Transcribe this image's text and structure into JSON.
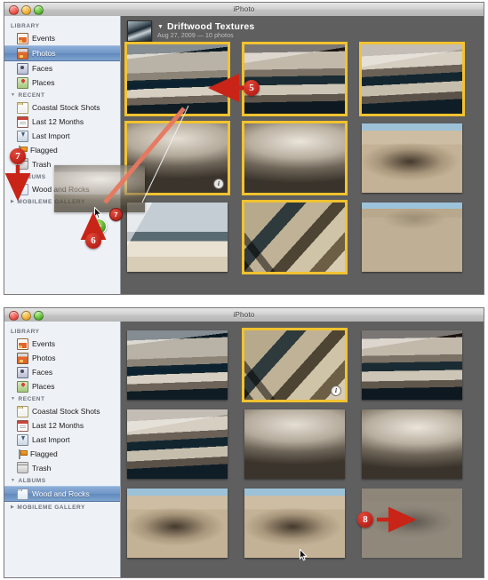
{
  "panels": [
    {
      "window_title": "iPhoto",
      "sidebar": {
        "sections": [
          {
            "name": "LIBRARY",
            "collapsible": false,
            "items": [
              {
                "label": "Events",
                "icon": "events-icon",
                "selected": false
              },
              {
                "label": "Photos",
                "icon": "photos-icon",
                "selected": true
              },
              {
                "label": "Faces",
                "icon": "faces-icon",
                "selected": false
              },
              {
                "label": "Places",
                "icon": "places-icon",
                "selected": false
              }
            ]
          },
          {
            "name": "RECENT",
            "collapsible": true,
            "items": [
              {
                "label": "Coastal Stock Shots",
                "icon": "folder-icon",
                "selected": false
              },
              {
                "label": "Last 12 Months",
                "icon": "calendar-icon",
                "selected": false
              },
              {
                "label": "Last Import",
                "icon": "import-icon",
                "selected": false
              },
              {
                "label": "Flagged",
                "icon": "flag-icon",
                "selected": false
              },
              {
                "label": "Trash",
                "icon": "trash-icon",
                "selected": false
              }
            ]
          },
          {
            "name": "ALBUMS",
            "collapsible": true,
            "items": [
              {
                "label": "Wood and Rocks",
                "icon": "album-icon",
                "selected": false
              }
            ]
          },
          {
            "name": "MOBILEME GALLERY",
            "collapsible": true,
            "items": []
          }
        ]
      },
      "event": {
        "title": "Driftwood Textures",
        "subtitle": "Aug 27, 2009 — 10 photos",
        "disclosure": "▼"
      },
      "grid": [
        [
          {
            "texture": "tx-strata",
            "selected": true,
            "info_badge": null,
            "faded": false
          },
          {
            "texture": "tx-strata2",
            "selected": true,
            "info_badge": null,
            "faded": false
          },
          {
            "texture": "tx-strata3",
            "selected": true,
            "info_badge": null,
            "faded": false
          }
        ],
        [
          {
            "texture": "tx-log",
            "selected": true,
            "info_badge": "i",
            "faded": false
          },
          {
            "texture": "tx-log2",
            "selected": true,
            "info_badge": null,
            "faded": false
          },
          {
            "texture": "tx-beach",
            "selected": false,
            "info_badge": null,
            "faded": false
          }
        ],
        [
          {
            "texture": "tx-tools",
            "selected": false,
            "info_badge": null,
            "faded": false
          },
          {
            "texture": "tx-planks",
            "selected": true,
            "info_badge": null,
            "faded": false
          },
          {
            "texture": "tx-sand",
            "selected": false,
            "info_badge": null,
            "faded": false
          }
        ]
      ],
      "drag": {
        "badge_count": "7",
        "drop_indicator": "+",
        "target_item": "Wood and Rocks"
      }
    },
    {
      "window_title": "iPhoto",
      "sidebar": {
        "sections": [
          {
            "name": "LIBRARY",
            "collapsible": false,
            "items": [
              {
                "label": "Events",
                "icon": "events-icon",
                "selected": false
              },
              {
                "label": "Photos",
                "icon": "photos-icon",
                "selected": false
              },
              {
                "label": "Faces",
                "icon": "faces-icon",
                "selected": false
              },
              {
                "label": "Places",
                "icon": "places-icon",
                "selected": false
              }
            ]
          },
          {
            "name": "RECENT",
            "collapsible": true,
            "items": [
              {
                "label": "Coastal Stock Shots",
                "icon": "folder-icon",
                "selected": false
              },
              {
                "label": "Last 12 Months",
                "icon": "calendar-icon",
                "selected": false
              },
              {
                "label": "Last Import",
                "icon": "import-icon",
                "selected": false
              },
              {
                "label": "Flagged",
                "icon": "flag-icon",
                "selected": false
              },
              {
                "label": "Trash",
                "icon": "trash-icon",
                "selected": false
              }
            ]
          },
          {
            "name": "ALBUMS",
            "collapsible": true,
            "items": [
              {
                "label": "Wood and Rocks",
                "icon": "album-icon",
                "selected": true
              }
            ]
          },
          {
            "name": "MOBILEME GALLERY",
            "collapsible": true,
            "items": []
          }
        ]
      },
      "grid": [
        [
          {
            "texture": "tx-strata",
            "selected": false,
            "info_badge": null,
            "faded": false
          },
          {
            "texture": "tx-planks",
            "selected": true,
            "info_badge": "i",
            "faded": false
          },
          {
            "texture": "tx-strata2",
            "selected": false,
            "info_badge": null,
            "faded": false
          }
        ],
        [
          {
            "texture": "tx-strata3",
            "selected": false,
            "info_badge": null,
            "faded": false
          },
          {
            "texture": "tx-log",
            "selected": false,
            "info_badge": null,
            "faded": false
          },
          {
            "texture": "tx-log2",
            "selected": false,
            "info_badge": null,
            "faded": false
          }
        ],
        [
          {
            "texture": "tx-beach",
            "selected": false,
            "info_badge": null,
            "faded": false
          },
          {
            "texture": "tx-beach",
            "selected": false,
            "info_badge": null,
            "faded": false
          },
          {
            "texture": "tx-driftA",
            "selected": false,
            "info_badge": null,
            "faded": true
          }
        ]
      ]
    }
  ],
  "callouts": [
    {
      "number": "5",
      "target": "first-selected-thumbnail-top-panel"
    },
    {
      "number": "6",
      "target": "drop-plus-indicator"
    },
    {
      "number": "7",
      "target": "wood-and-rocks-album-row"
    },
    {
      "number": "8",
      "target": "newly-added-photo-bottom-panel"
    }
  ],
  "colors": {
    "selection_yellow": "#f2c230",
    "sidebar_selection_blue": "#6f95c6",
    "content_background": "#5f5f5f",
    "sidebar_background": "#eef1f6",
    "callout_red": "#b51f18",
    "drop_green": "#3f9c1d"
  }
}
